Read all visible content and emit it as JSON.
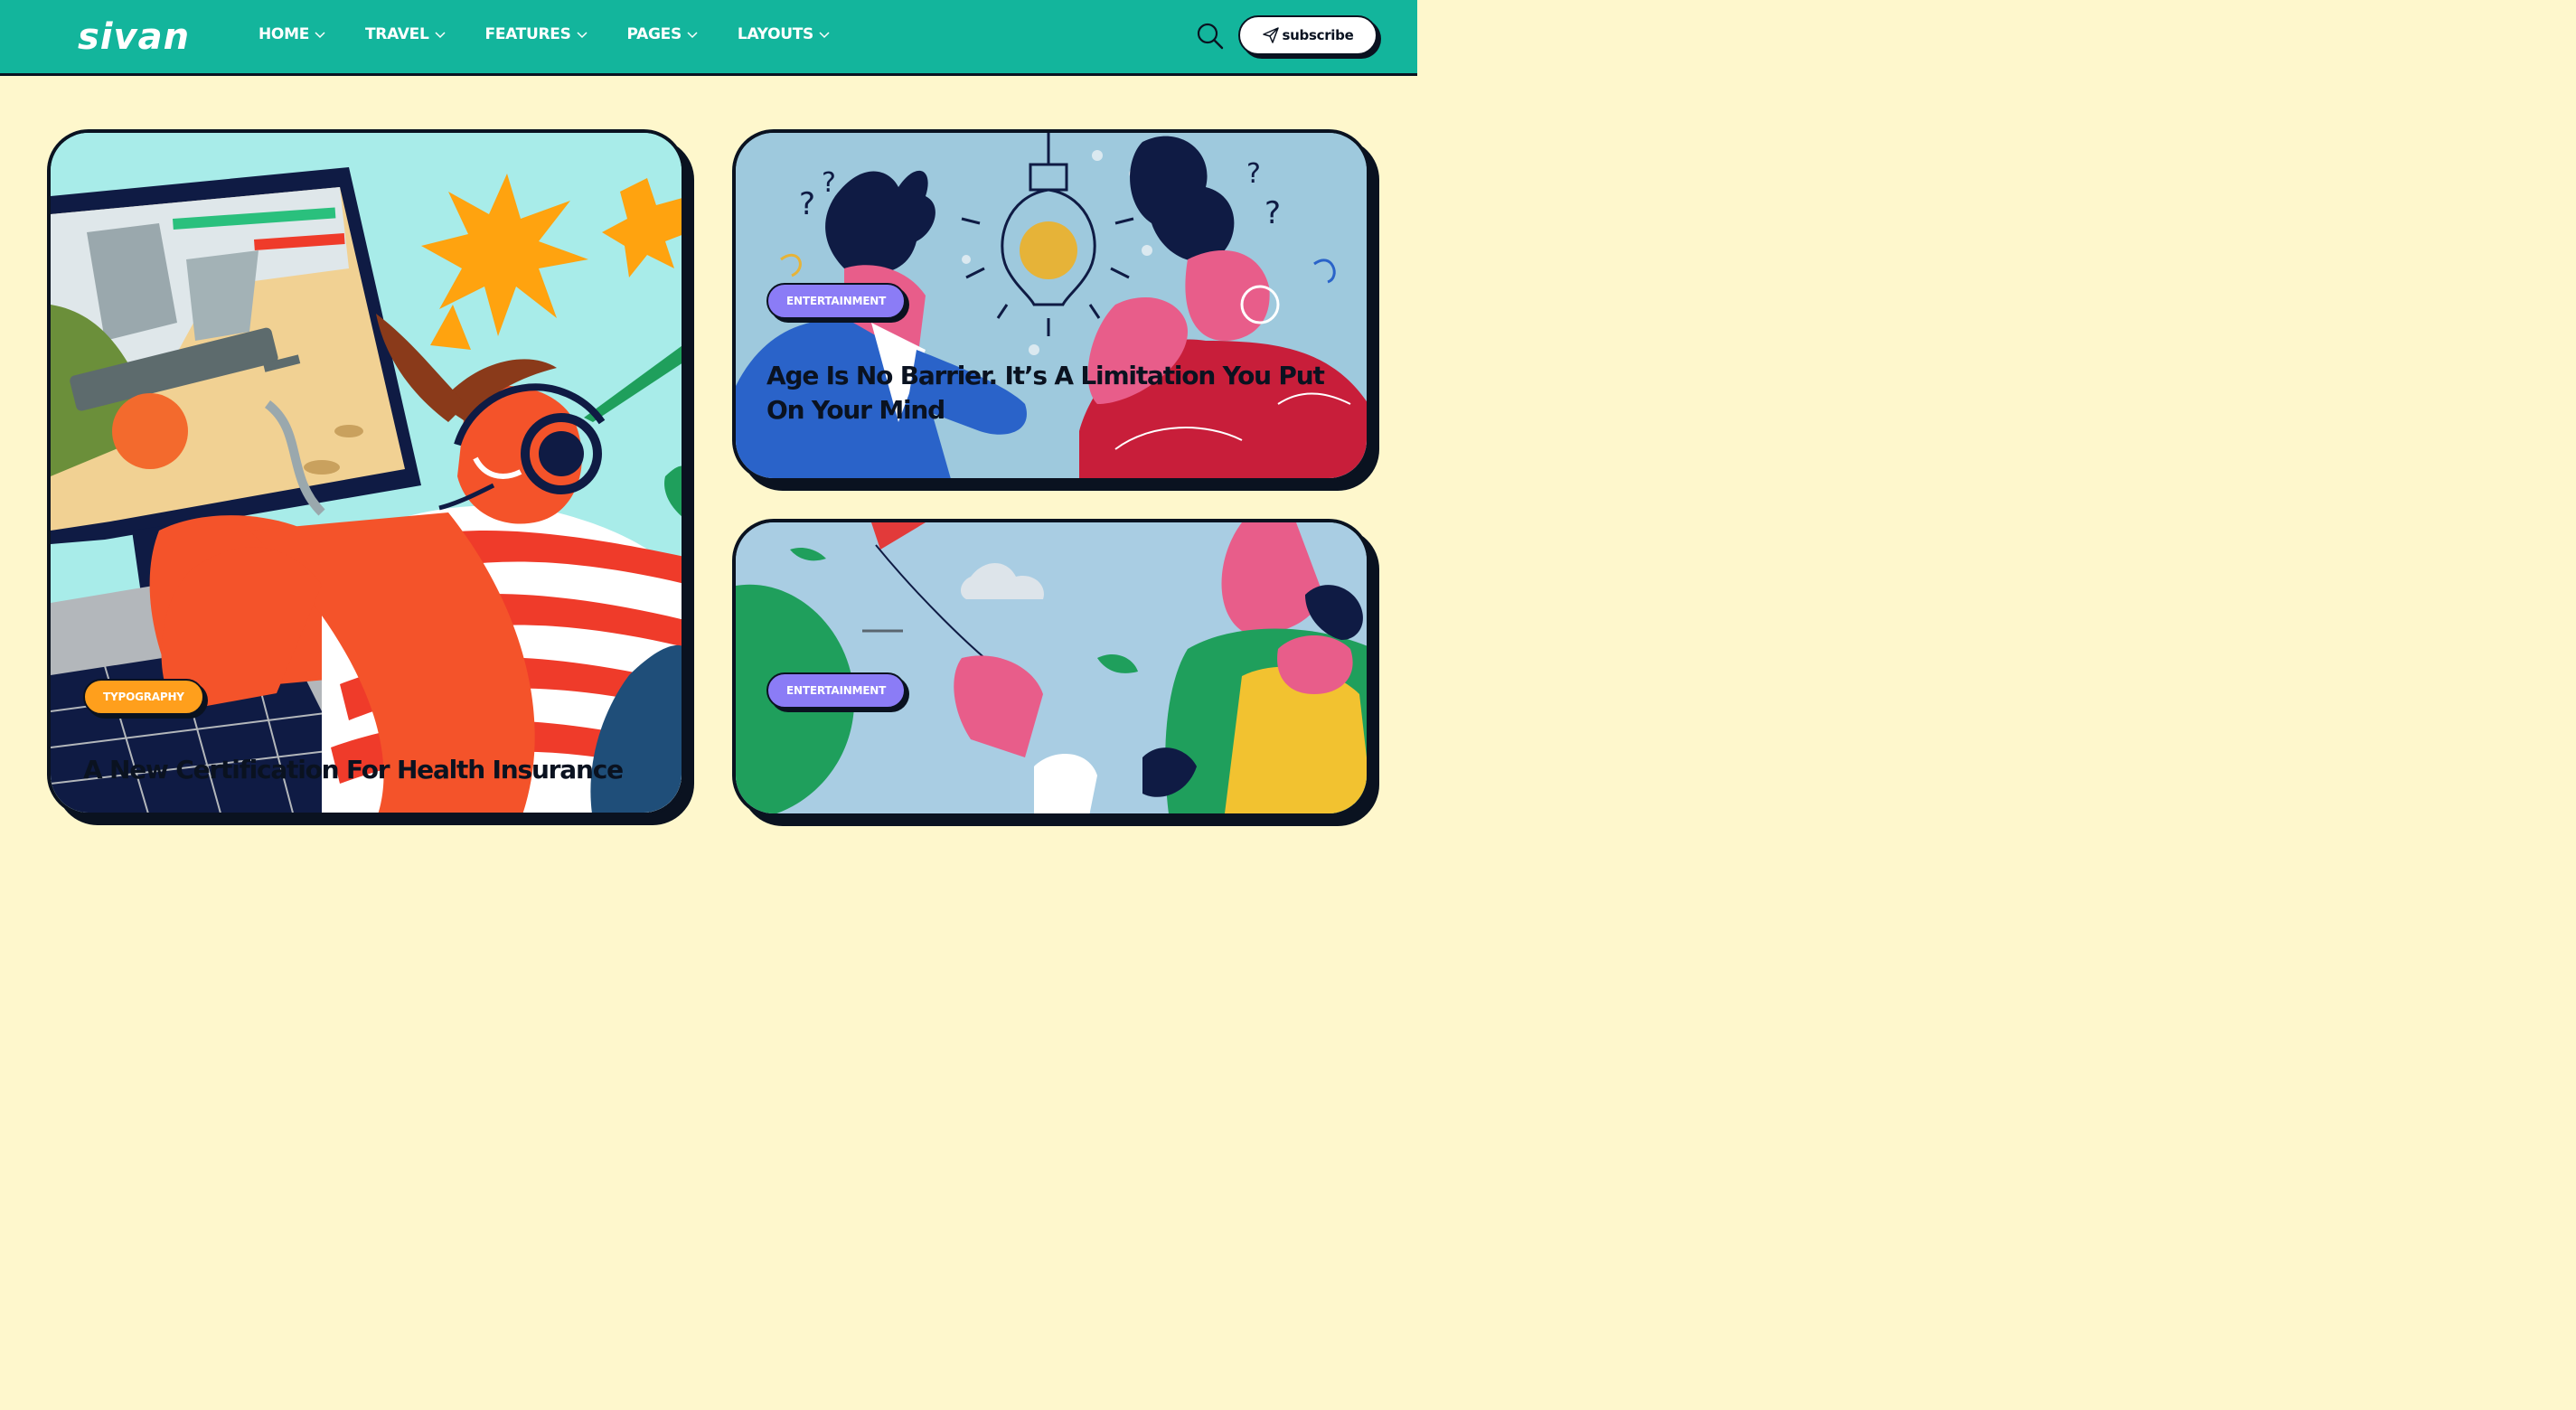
{
  "brand": {
    "logo_text": "sivan"
  },
  "nav": {
    "items": [
      {
        "label": "HOME"
      },
      {
        "label": "TRAVEL"
      },
      {
        "label": "FEATURES"
      },
      {
        "label": "PAGES"
      },
      {
        "label": "LAYOUTS"
      }
    ]
  },
  "header": {
    "subscribe_label": "subscribe"
  },
  "posts": [
    {
      "category": "TYPOGRAPHY",
      "title": "A New Certification For Health Insurance"
    },
    {
      "category": "ENTERTAINMENT",
      "title": "Age Is No Barrier. It’s A Limitation You Put On Your Mind"
    },
    {
      "category": "ENTERTAINMENT",
      "title": ""
    }
  ],
  "colors": {
    "header_bg": "#13b59c",
    "page_bg": "#fef7cc",
    "outline": "#0a1220",
    "badge_purple": "#8b7cf6",
    "badge_orange": "#ff9f1c"
  }
}
